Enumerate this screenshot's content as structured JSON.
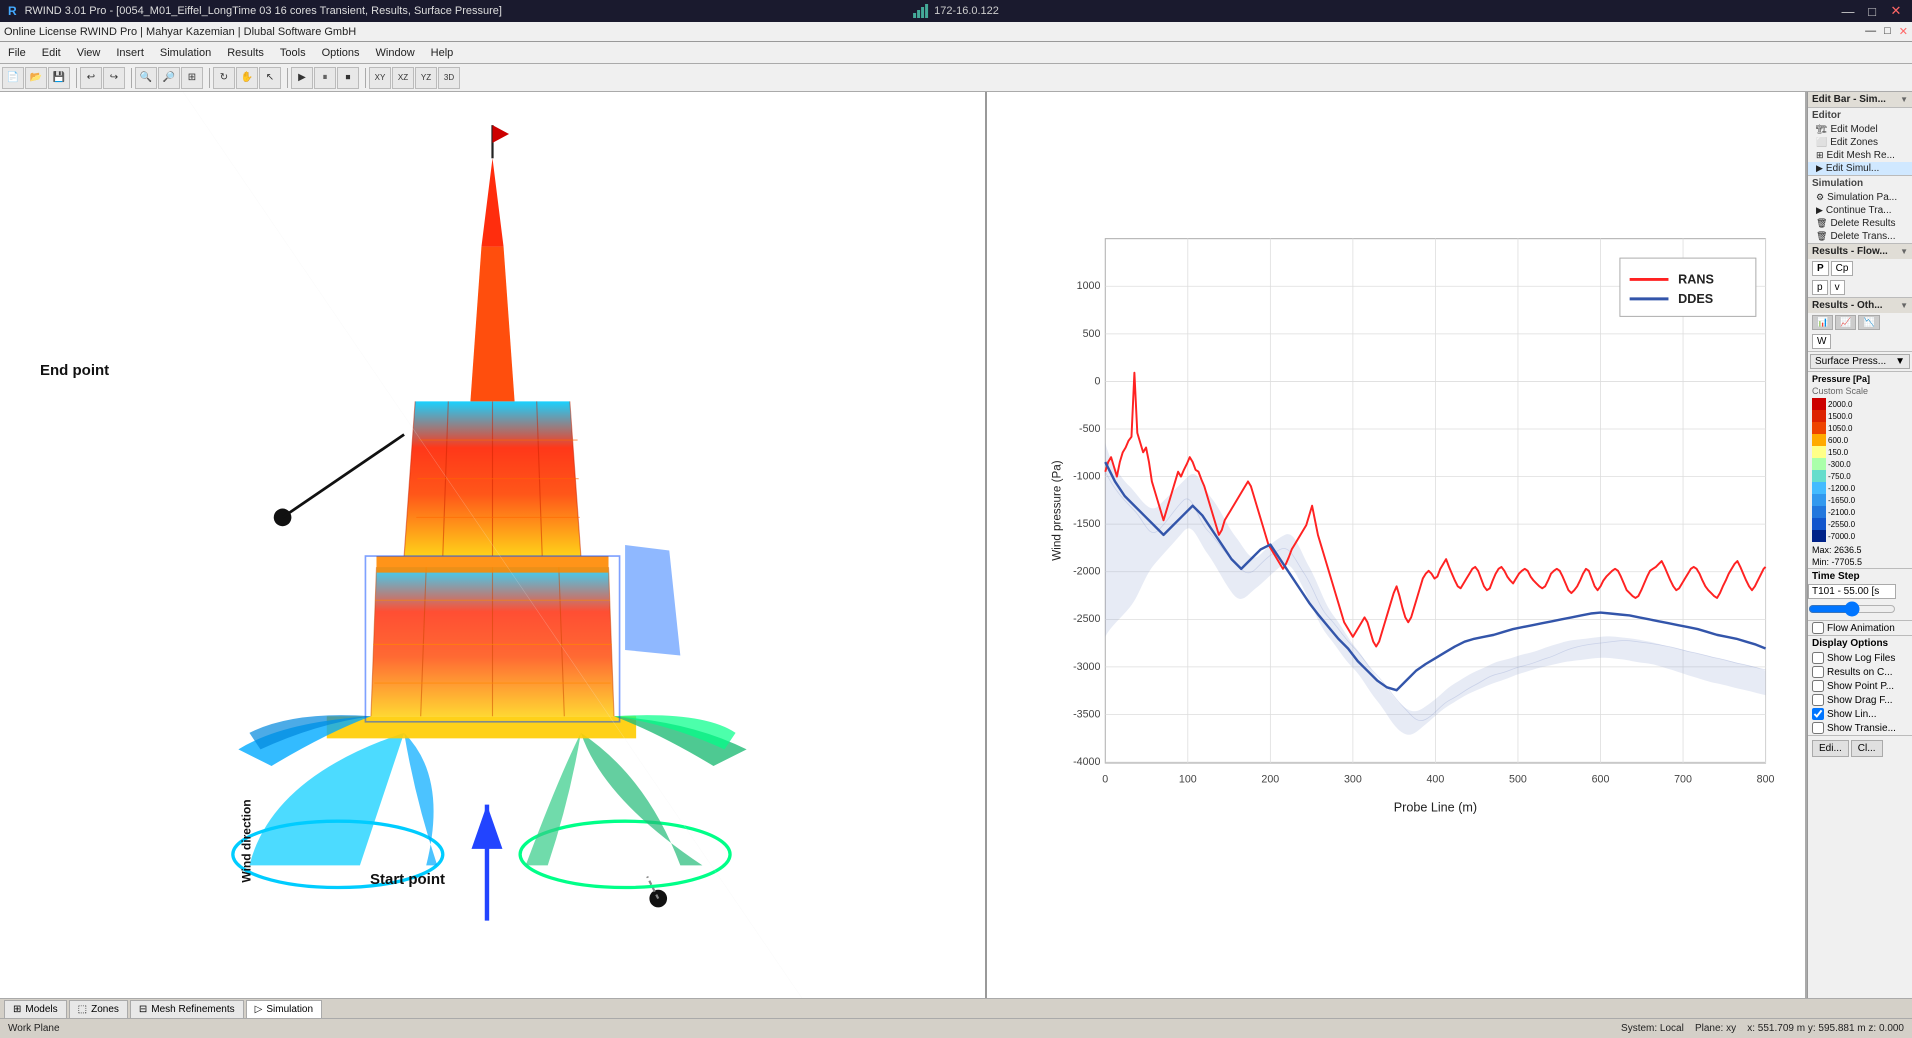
{
  "titleBar": {
    "title": "RWIND 3.01 Pro - [0054_M01_Eiffel_LongTime 03 16 cores Transient, Results, Surface Pressure]",
    "ip": "172-16.0.122",
    "licenseInfo": "Online License RWIND Pro | Mahyar Kazemian | Dlubal Software GmbH",
    "minimizeBtn": "—",
    "maximizeBtn": "□",
    "closeBtn": "✕"
  },
  "menuBar": {
    "items": [
      "File",
      "Edit",
      "View",
      "Insert",
      "Simulation",
      "Results",
      "Tools",
      "Options",
      "Window",
      "Help"
    ]
  },
  "viewport": {
    "endPointLabel": "End point",
    "startPointLabel": "Start point",
    "windDirectionLabel": "Wind direction"
  },
  "chart": {
    "title": "",
    "yAxisLabel": "Wind pressure (Pa)",
    "xAxisLabel": "Probe Line (m)",
    "yMin": -4000,
    "yMax": 1000,
    "xMin": 0,
    "xMax": 800,
    "yTicks": [
      1000,
      500,
      0,
      -500,
      -1000,
      -1500,
      -2000,
      -2500,
      -3000,
      -3500,
      -4000
    ],
    "xTicks": [
      0,
      100,
      200,
      300,
      400,
      500,
      600,
      700,
      800
    ],
    "legend": [
      {
        "label": "RANS",
        "color": "#ff2222"
      },
      {
        "label": "DDES",
        "color": "#3355aa"
      }
    ]
  },
  "rightPanel": {
    "editSection": {
      "title": "Editor",
      "items": [
        "Edit Model",
        "Edit Zones",
        "Edit Mesh Re...",
        "Edit Simul..."
      ]
    },
    "simulationSection": {
      "title": "Simulation",
      "items": [
        "Simulation Pa...",
        "Continue Tra...",
        "Delete Results",
        "Delete Trans..."
      ]
    },
    "resultsFlowSection": {
      "title": "Results - Flow...",
      "buttons": [
        "P",
        "Cp",
        "p",
        "v"
      ]
    },
    "resultsOthSection": {
      "title": "Results - Oth...",
      "buttons": [
        "icon1",
        "icon2",
        "icon3",
        "W"
      ]
    },
    "surfacePressDropdown": "Surface Press...",
    "pressureScale": {
      "title": "Pressure [Pa]",
      "subtitle": "Custom Scale",
      "values": [
        2000.0,
        1500.0,
        1050.0,
        600.0,
        150.0,
        -300.0,
        -750.0,
        -1200.0,
        -1650.0,
        -2100.0,
        -2550.0,
        -7000.0
      ],
      "max": "Max: 2636.5",
      "min": "Min: -7705.5"
    },
    "timeStep": {
      "label": "Time Step",
      "value": "T101 - 55.00 [s"
    },
    "flowAnimation": "Flow Animation",
    "displayOptions": "Display Options",
    "checkboxes": [
      {
        "label": "Show Log Files",
        "checked": false
      },
      {
        "label": "Results on C...",
        "checked": false
      },
      {
        "label": "Show Point P...",
        "checked": false
      },
      {
        "label": "Show Drag F...",
        "checked": false
      },
      {
        "label": "Show Lin...",
        "checked": true
      },
      {
        "label": "Show Transie...",
        "checked": false
      }
    ]
  },
  "statusBar": {
    "leftText": "Work Plane",
    "systemText": "System: Local",
    "planeText": "Plane: xy",
    "coordText": "x: 551.709 m  y: 595.881 m  z: 0.000"
  },
  "bottomTabs": [
    {
      "label": "Models",
      "icon": "grid",
      "active": false
    },
    {
      "label": "Zones",
      "icon": "zone",
      "active": false
    },
    {
      "label": "Mesh Refinements",
      "icon": "mesh",
      "active": false
    },
    {
      "label": "Simulation",
      "icon": "sim",
      "active": true
    }
  ]
}
